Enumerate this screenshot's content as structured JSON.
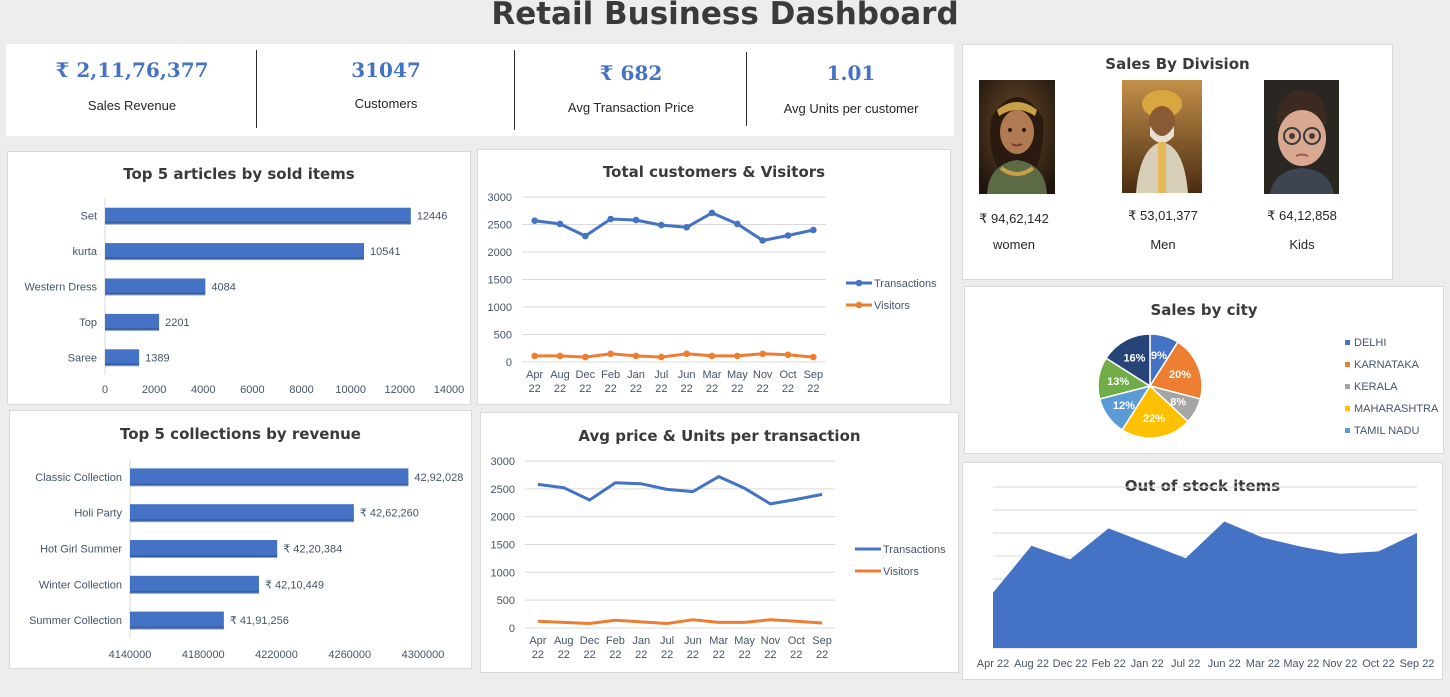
{
  "title": "Retail Business Dashboard",
  "kpis": [
    {
      "value": "₹ 2,11,76,377",
      "label": "Sales Revenue"
    },
    {
      "value": "31047",
      "label": "Customers"
    },
    {
      "value": "₹ 682",
      "label": "Avg Transaction Price"
    },
    {
      "value": "1.01",
      "label": "Avg Units per customer"
    }
  ],
  "division": {
    "title": "Sales By Division",
    "items": [
      {
        "amount": "₹ 94,62,142",
        "label": "women"
      },
      {
        "amount": "₹ 53,01,377",
        "label": "Men"
      },
      {
        "amount": "₹ 64,12,858",
        "label": "Kids"
      }
    ]
  },
  "colors": {
    "blue": "#4472c4",
    "orange": "#ed7d31",
    "grey": "#a5a5a5",
    "gold": "#ffc000",
    "lightblue": "#5b9bd5",
    "green": "#70ad47",
    "navy": "#264478"
  },
  "chart_data": [
    {
      "id": "articles",
      "type": "bar",
      "orientation": "horizontal",
      "title": "Top 5 articles by sold items",
      "categories": [
        "Set",
        "kurta",
        "Western Dress",
        "Top",
        "Saree"
      ],
      "values": [
        12446,
        10541,
        4084,
        2201,
        1389
      ],
      "data_labels": [
        "12446",
        "10541",
        "4084",
        "2201",
        "1389"
      ],
      "xlim": [
        0,
        14000
      ],
      "xticks": [
        "0",
        "2000",
        "4000",
        "6000",
        "8000",
        "10000",
        "12000",
        "14000"
      ]
    },
    {
      "id": "collections",
      "type": "bar",
      "orientation": "horizontal",
      "title": "Top 5 collections by revenue",
      "categories": [
        "Classic Collection",
        "Holi Party",
        "Hot Girl Summer",
        "Winter Collection",
        "Summer Collection"
      ],
      "values": [
        4292028,
        4262260,
        4220384,
        4210449,
        4191256
      ],
      "data_labels": [
        "42,92,028",
        "₹ 42,62,260",
        "₹ 42,20,384",
        "₹ 42,10,449",
        "₹ 41,91,256"
      ],
      "xlim": [
        4140000,
        4300000
      ],
      "xticks": [
        "4140000",
        "4180000",
        "4220000",
        "4260000",
        "4300000"
      ]
    },
    {
      "id": "visitors",
      "type": "line",
      "title": "Total customers & Visitors",
      "categories": [
        "Apr 22",
        "Aug 22",
        "Dec 22",
        "Feb 22",
        "Jan 22",
        "Jul 22",
        "Jun 22",
        "Mar 22",
        "May 22",
        "Nov 22",
        "Oct 22",
        "Sep 22"
      ],
      "series": [
        {
          "name": "Transactions",
          "values": [
            2570,
            2510,
            2290,
            2600,
            2580,
            2490,
            2450,
            2710,
            2510,
            2210,
            2300,
            2400
          ]
        },
        {
          "name": "Visitors",
          "values": [
            110,
            110,
            90,
            150,
            110,
            90,
            150,
            110,
            110,
            150,
            130,
            90
          ]
        }
      ],
      "ylim": [
        0,
        3000
      ],
      "yticks": [
        "0",
        "500",
        "1000",
        "1500",
        "2000",
        "2500",
        "3000"
      ],
      "markers": true
    },
    {
      "id": "avgprice",
      "type": "line",
      "title": "Avg price & Units per transaction",
      "categories": [
        "Apr 22",
        "Aug 22",
        "Dec 22",
        "Feb 22",
        "Jan 22",
        "Jul 22",
        "Jun 22",
        "Mar 22",
        "May 22",
        "Nov 22",
        "Oct 22",
        "Sep 22"
      ],
      "series": [
        {
          "name": "Transactions",
          "values": [
            2580,
            2520,
            2300,
            2610,
            2590,
            2490,
            2450,
            2720,
            2510,
            2230,
            2310,
            2400
          ]
        },
        {
          "name": "Visitors",
          "values": [
            120,
            100,
            80,
            140,
            110,
            80,
            150,
            100,
            100,
            150,
            120,
            90
          ]
        }
      ],
      "ylim": [
        0,
        3000
      ],
      "yticks": [
        "0",
        "500",
        "1000",
        "1500",
        "2000",
        "2500",
        "3000"
      ],
      "markers": false
    },
    {
      "id": "city",
      "type": "pie",
      "title": "Sales by city",
      "slices": [
        {
          "label": "DELHI",
          "value": 9,
          "text": "9%"
        },
        {
          "label": "KARNATAKA",
          "value": 20,
          "text": "20%"
        },
        {
          "label": "KERALA",
          "value": 8,
          "text": "8%"
        },
        {
          "label": "MAHARASHTRA",
          "value": 22,
          "text": "22%"
        },
        {
          "label": "TAMIL NADU",
          "value": 12,
          "text": "12%"
        },
        {
          "label": "",
          "value": 13,
          "text": "13%"
        },
        {
          "label": "",
          "value": 16,
          "text": "16%"
        }
      ],
      "legend": "right"
    },
    {
      "id": "stock",
      "type": "area",
      "title": "Out of stock items",
      "categories": [
        "Apr 22",
        "Aug 22",
        "Dec 22",
        "Feb 22",
        "Jan 22",
        "Jul 22",
        "Jun 22",
        "Mar 22",
        "May 22",
        "Nov 22",
        "Oct 22",
        "Sep 22"
      ],
      "values": [
        48,
        89,
        77,
        104,
        91,
        78,
        110,
        96,
        88,
        82,
        84,
        100
      ],
      "ylim": [
        0,
        140
      ],
      "grid": true
    }
  ]
}
